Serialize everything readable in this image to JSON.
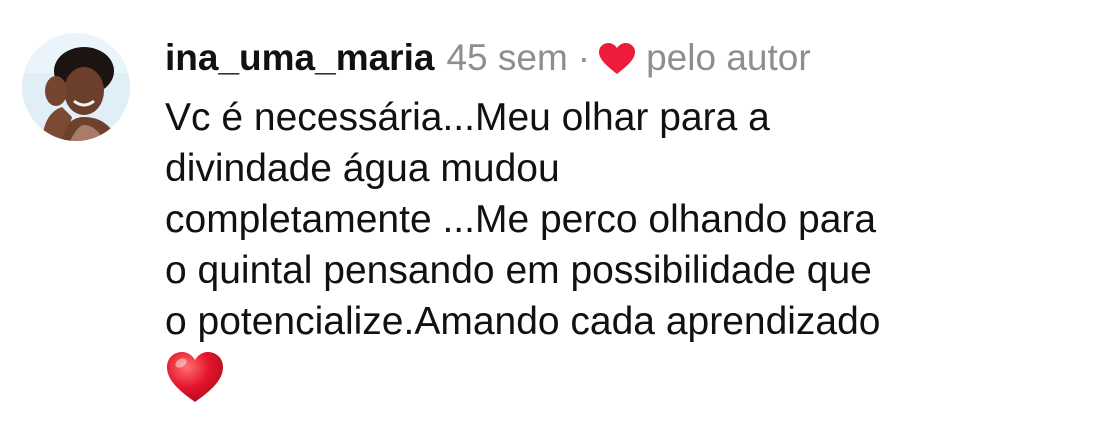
{
  "comment": {
    "username": "ina_uma_maria",
    "time": "45 sem",
    "separator": "·",
    "liked_by": "pelo autor",
    "text_lines": [
      "Vc é necessária...Meu olhar para a",
      "divindade água mudou",
      "completamente ...Me perco olhando para",
      "o quintal pensando em possibilidade que",
      "o potencialize.Amando cada aprendizado"
    ],
    "emoji": "red-heart"
  },
  "colors": {
    "text": "#111111",
    "meta_gray": "#8e8e8e",
    "heart_red": "#ed1c3b"
  },
  "icons": {
    "avatar": "avatar",
    "liked_by_author": "heart-icon",
    "emoji": "heart-emoji-icon"
  }
}
